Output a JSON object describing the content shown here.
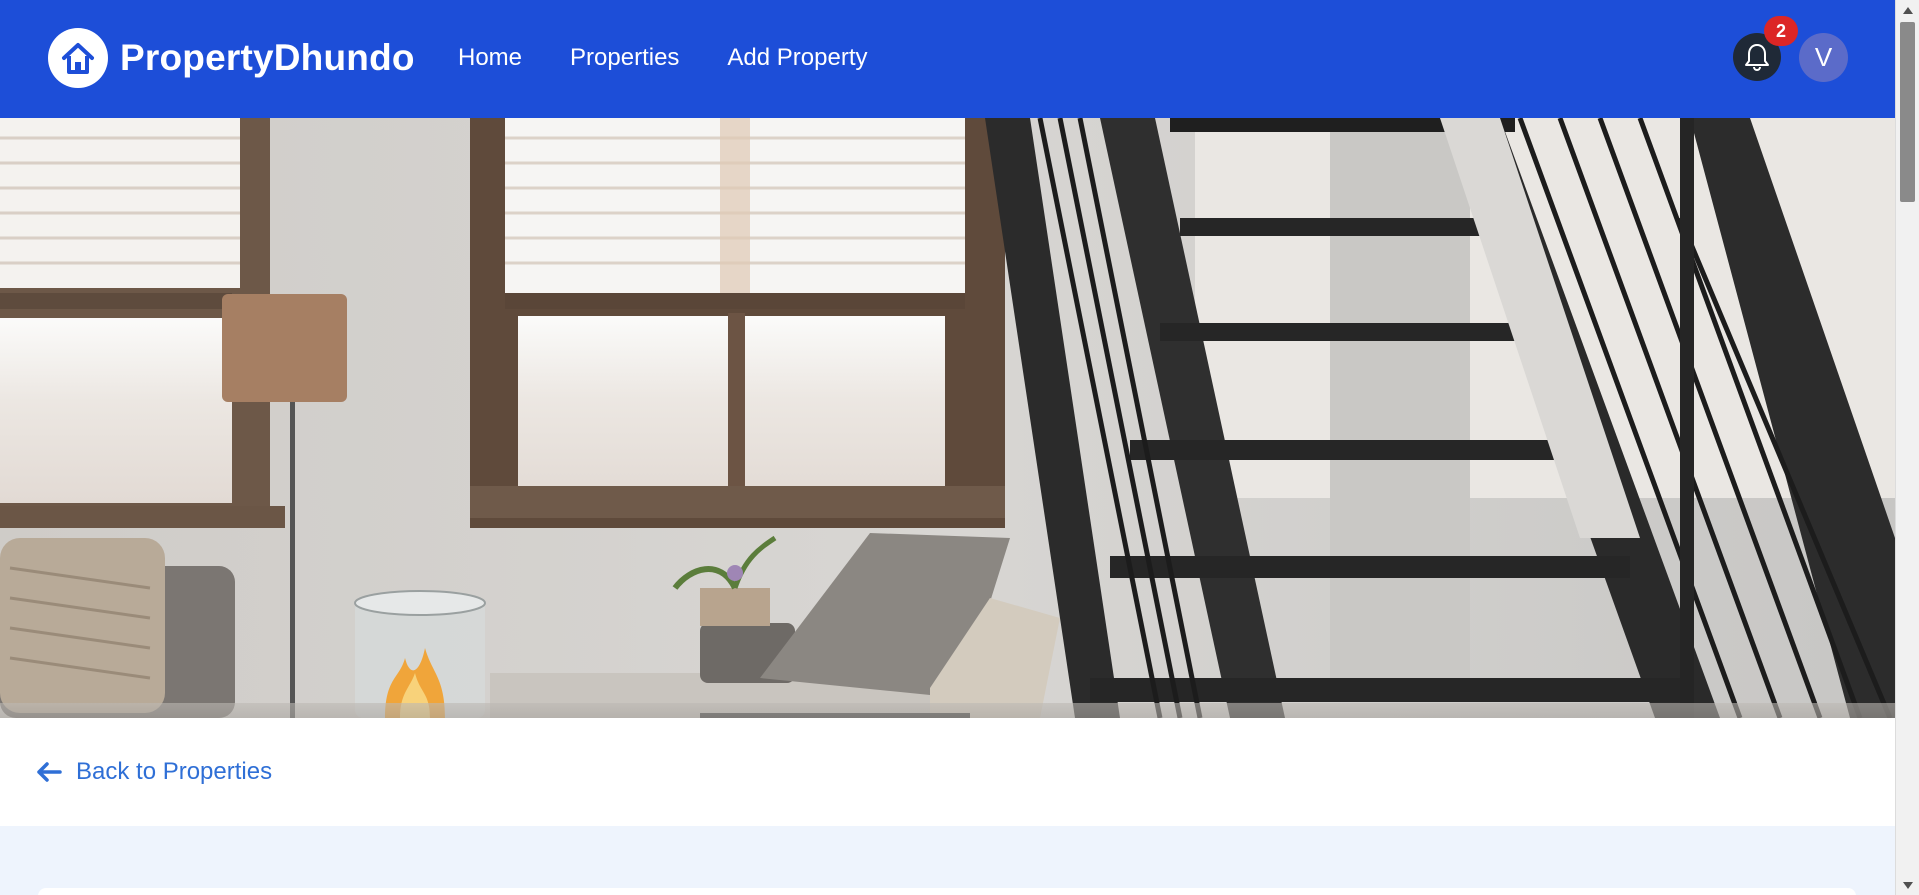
{
  "app": {
    "brand_name": "PropertyDhundo",
    "brand_icon": "house-icon"
  },
  "nav": {
    "items": [
      {
        "label": "Home"
      },
      {
        "label": "Properties"
      },
      {
        "label": "Add Property"
      }
    ]
  },
  "notifications": {
    "icon": "bell-icon",
    "count": "2"
  },
  "user": {
    "initial": "V"
  },
  "hero": {
    "image": "living-room-with-staircase"
  },
  "back_link": {
    "label": "Back to Properties",
    "icon": "arrow-left-icon"
  },
  "colors": {
    "header_bg": "#1d4ed8",
    "badge_bg": "#dc2626",
    "avatar_bg": "#5b6bc9",
    "link": "#2f6fd6",
    "section_bg": "#eef4fd"
  }
}
